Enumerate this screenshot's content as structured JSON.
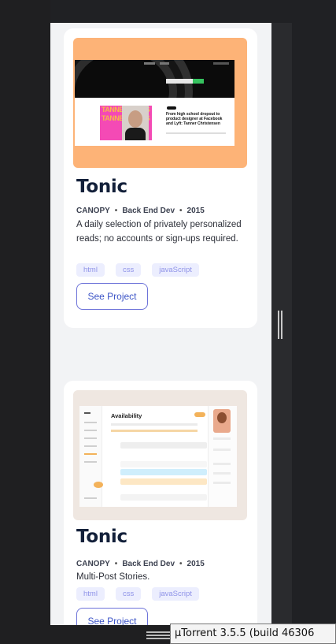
{
  "cards": [
    {
      "title": "Tonic",
      "company": "CANOPY",
      "role": "Back End Dev",
      "year": "2015",
      "description": "A daily selection of privately personalized reads; no accounts or sign-ups required.",
      "tags": [
        "html",
        "css",
        "javaScript"
      ],
      "button": "See Project",
      "preview": {
        "headline": "From high school dropout to product designer at Facebook and Lyft: Tanner Christensen",
        "poster_text": "TANNER CHRIS TANNER CHRIS"
      },
      "thumb_color": "#fdb377"
    },
    {
      "title": "Tonic",
      "company": "CANOPY",
      "role": "Back End Dev",
      "year": "2015",
      "description": "Multi-Post Stories.",
      "tags": [
        "html",
        "css",
        "javaScript"
      ],
      "button": "See Project",
      "preview": {
        "heading": "Availability"
      },
      "thumb_color": "#efe7e1"
    }
  ],
  "tooltip": {
    "text": "µTorrent 3.5.5  (build 46306"
  },
  "colors": {
    "title": "#13203a",
    "tag_text": "#8f93e8",
    "tag_bg": "#eceefe",
    "button_border": "#6d73d9",
    "button_text": "#3d55c7",
    "page_bg": "#f2f3f5",
    "window_dark": "#202124"
  }
}
